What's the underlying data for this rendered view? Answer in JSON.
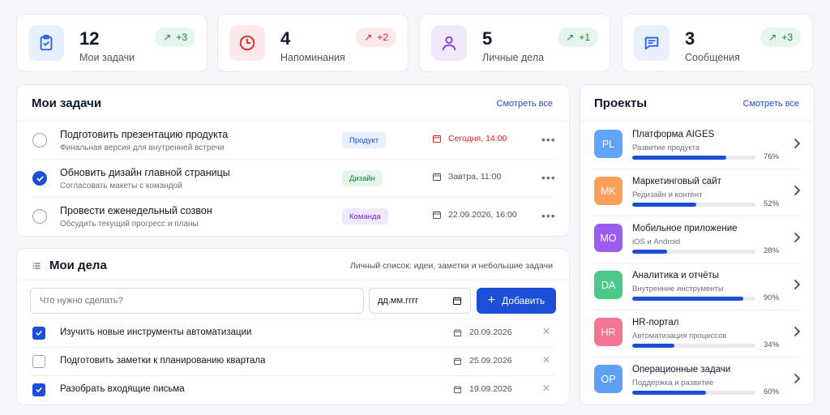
{
  "stats": [
    {
      "value": "12",
      "label": "Мои задачи",
      "delta": "+3",
      "icon": "clipboard-icon",
      "color": "#2563eb",
      "bg": "#e8effd"
    },
    {
      "value": "4",
      "label": "Напоминания",
      "delta": "+2",
      "icon": "clock-icon",
      "color": "#dc2626",
      "bg": "#fde8ea"
    },
    {
      "value": "5",
      "label": "Личные дела",
      "delta": "+1",
      "icon": "user-icon",
      "color": "#7c3aed",
      "bg": "#efe9fb"
    },
    {
      "value": "3",
      "label": "Сообщения",
      "delta": "+3",
      "icon": "chat-icon",
      "color": "#2563eb",
      "bg": "#e8effd"
    }
  ],
  "tasks": {
    "title": "Мои задачи",
    "see_all": "Смотреть все",
    "items": [
      {
        "title": "Подготовить презентацию продукта",
        "subtitle": "Финальная версия для внутренней встречи",
        "tag": "Продукт",
        "date": "Сегодня, 14:00",
        "done": false
      },
      {
        "title": "Обновить дизайн главной страницы",
        "subtitle": "Согласовать макеты с командой",
        "tag": "Дизайн",
        "date": "Завтра, 11:00",
        "done": true
      },
      {
        "title": "Провести еженедельный созвон",
        "subtitle": "Обсудить текущий прогресс и планы",
        "tag": "Команда",
        "date": "22.09.2026, 16:00",
        "done": false
      }
    ]
  },
  "todo": {
    "title": "Мои дела",
    "subtitle": "Личный список: идеи, заметки и небольшие задачи",
    "input_placeholder": "Что нужно сделать?",
    "date_placeholder": "дд.мм.гггг",
    "add_label": "Добавить",
    "items": [
      {
        "text": "Изучить новые инструменты автоматизации",
        "date": "20.09.2026",
        "done": true
      },
      {
        "text": "Подготовить заметки к планированию квартала",
        "date": "25.09.2026",
        "done": false
      },
      {
        "text": "Разобрать входящие письма",
        "date": "19.09.2026",
        "done": true
      }
    ]
  },
  "projects": {
    "title": "Проекты",
    "see_all": "Смотреть все",
    "items": [
      {
        "initials": "PL",
        "name": "Платформа AIGES",
        "subtitle": "Развитие продукта",
        "progress": 76,
        "progress_label": "76%",
        "color": "#60a5fa"
      },
      {
        "initials": "MK",
        "name": "Маркетинговый сайт",
        "subtitle": "Редизайн и контент",
        "progress": 52,
        "progress_label": "52%",
        "color": "#fb9f5a"
      },
      {
        "initials": "MO",
        "name": "Мобильное приложение",
        "subtitle": "iOS и Android",
        "progress": 28,
        "progress_label": "28%",
        "color": "#9b5cf0"
      },
      {
        "initials": "DA",
        "name": "Аналитика и отчёты",
        "subtitle": "Внутренние инструменты",
        "progress": 90,
        "progress_label": "90%",
        "color": "#4cc98a"
      },
      {
        "initials": "HR",
        "name": "HR-портал",
        "subtitle": "Автоматизация процессов",
        "progress": 34,
        "progress_label": "34%",
        "color": "#f47592"
      },
      {
        "initials": "OP",
        "name": "Операционные задачи",
        "subtitle": "Поддержка и развитие",
        "progress": 60,
        "progress_label": "60%",
        "color": "#5fa0f5"
      }
    ]
  }
}
